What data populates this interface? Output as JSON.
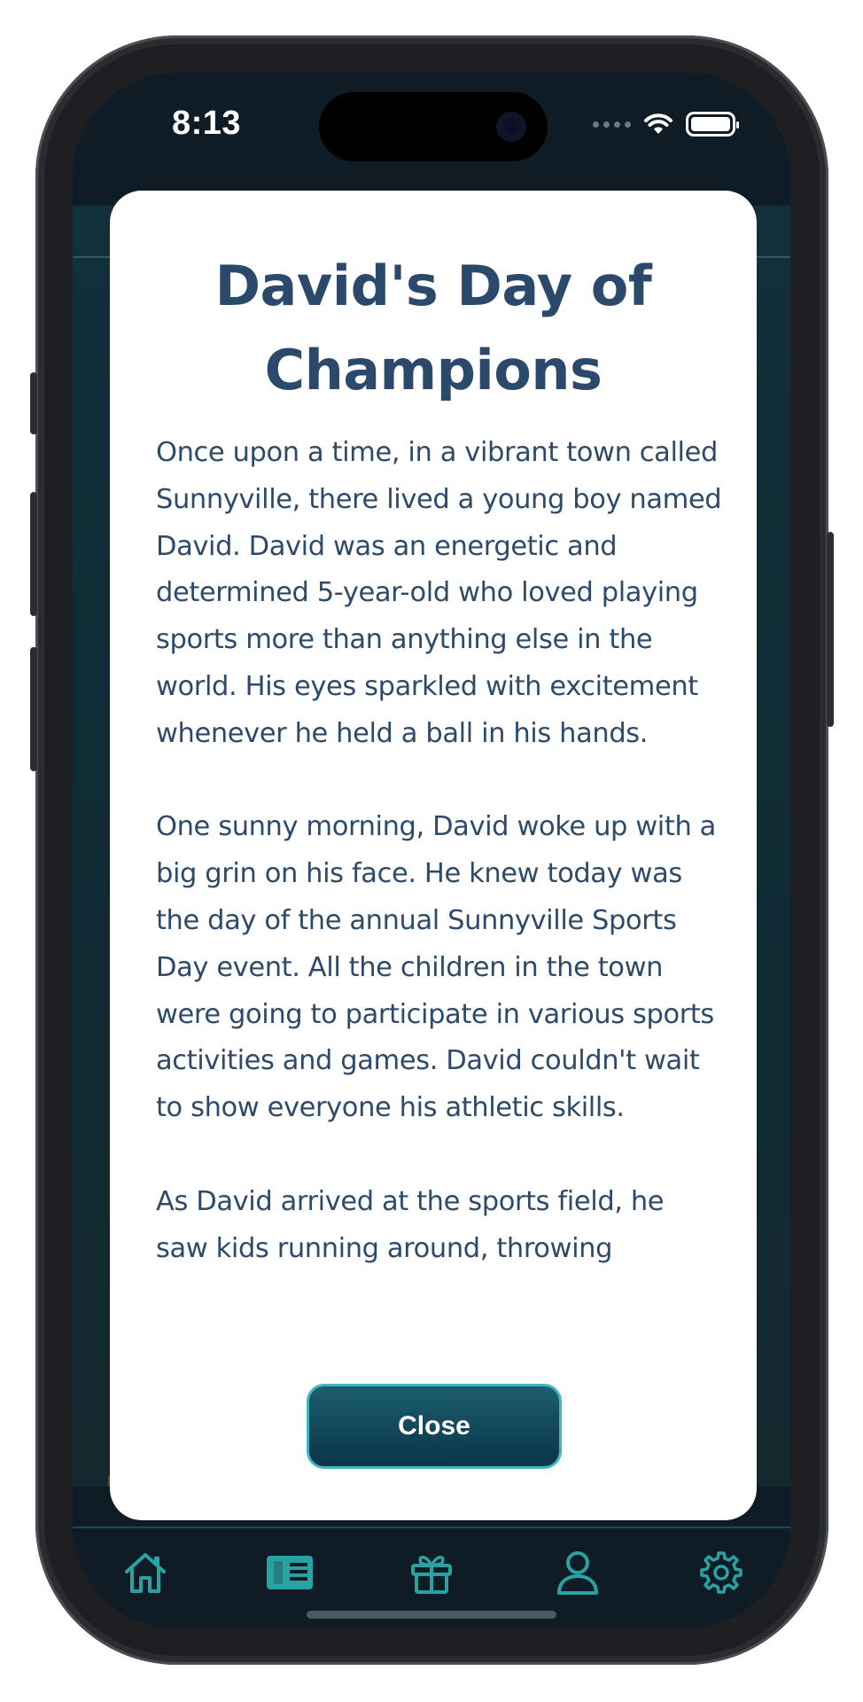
{
  "status_bar": {
    "time": "8:13"
  },
  "modal": {
    "title": "David's Day of Champions",
    "paragraphs": [
      "Once upon a time, in a vibrant town called Sunnyville, there lived a young boy named David. David was an energetic and determined 5-year-old who loved playing sports more than anything else in the world. His eyes sparkled with excitement whenever he held a ball in his hands.",
      "One sunny morning, David woke up with a big grin on his face. He knew today was the day of the annual Sunnyville Sports Day event. All the children in the town were going to participate in various sports activities and games. David couldn't wait to show everyone his athletic skills.",
      "As David arrived at the sports field, he saw kids running around, throwing"
    ],
    "close_label": "Close"
  },
  "tab_bar": {
    "items": [
      {
        "icon": "home-icon",
        "active": false
      },
      {
        "icon": "book-icon",
        "active": true
      },
      {
        "icon": "gift-icon",
        "active": false
      },
      {
        "icon": "profile-icon",
        "active": false
      },
      {
        "icon": "gear-icon",
        "active": false
      }
    ]
  },
  "colors": {
    "accent": "#2aa1a3",
    "title": "#2b4a6b",
    "text": "#2e4a6a",
    "button_top": "#1c5e70",
    "button_bottom": "#0b3448",
    "screen_bg": "#0f1c26"
  }
}
